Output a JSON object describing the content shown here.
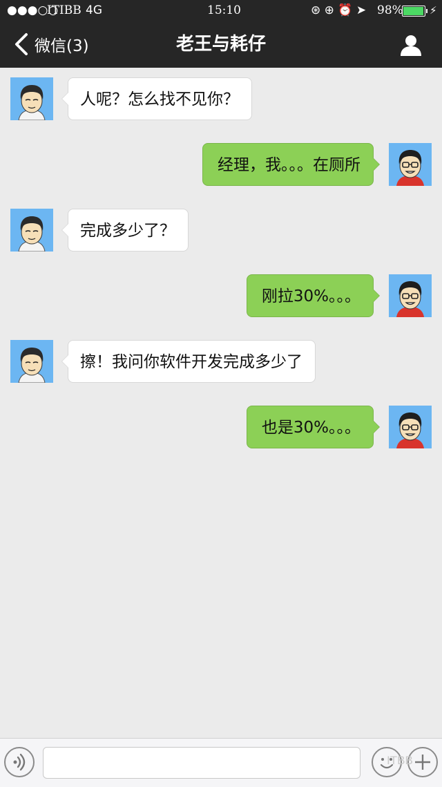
{
  "status_bar": {
    "signal": "●●●○○",
    "carrier": "ITIBB",
    "network": "4G",
    "time": "15:10",
    "icons": "⊛ ⊕ ⏰ ➤",
    "battery": "98%",
    "battery_level": 0.98,
    "charging": "⚡"
  },
  "nav": {
    "back_label": "微信(3)",
    "title": "老王与耗仔"
  },
  "messages": [
    {
      "side": "left",
      "text": "人呢？怎么找不见你？"
    },
    {
      "side": "right",
      "text": "经理，我。。。在厕所"
    },
    {
      "side": "left",
      "text": "完成多少了？"
    },
    {
      "side": "right",
      "text": "刚拉30%。。。"
    },
    {
      "side": "left",
      "text": "擦！我问你软件开发完成多少了"
    },
    {
      "side": "right",
      "text": "也是30%。。。"
    }
  ],
  "input_bar": {
    "text_value": "",
    "watermark": "ITBB"
  },
  "colors": {
    "nav_bg": "#262626",
    "chat_bg": "#ebebeb",
    "bubble_mine": "#8cd056",
    "bubble_other": "#ffffff",
    "avatar_bg": "#6cb6f2",
    "battery_fill": "#4cd964"
  }
}
